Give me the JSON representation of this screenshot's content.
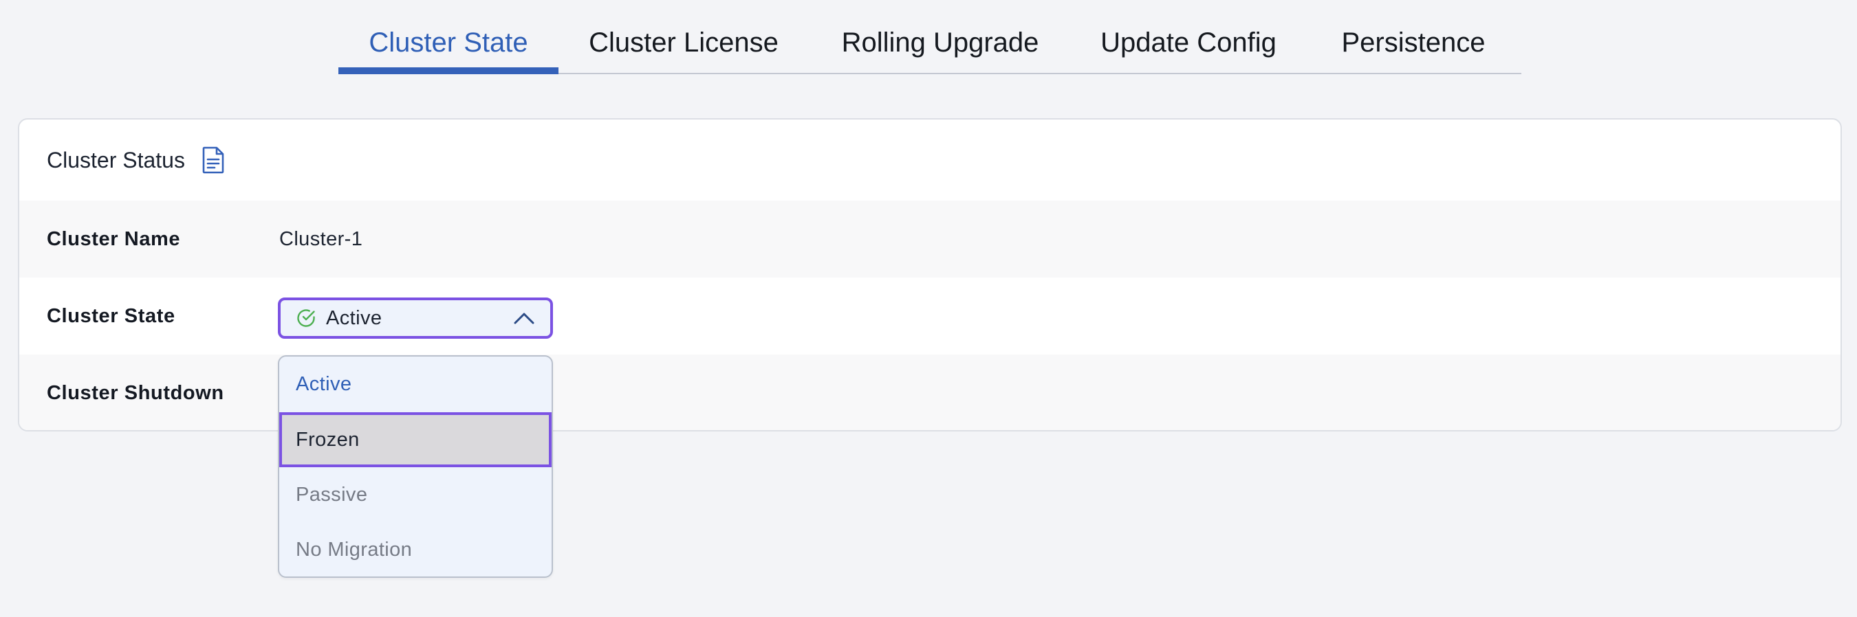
{
  "tabs": [
    {
      "label": "Cluster State",
      "active": true
    },
    {
      "label": "Cluster License",
      "active": false
    },
    {
      "label": "Rolling Upgrade",
      "active": false
    },
    {
      "label": "Update Config",
      "active": false
    },
    {
      "label": "Persistence",
      "active": false
    }
  ],
  "panel": {
    "title": "Cluster Status",
    "title_icon": "document-icon",
    "rows": [
      {
        "label": "Cluster Name",
        "value": "Cluster-1"
      },
      {
        "label": "Cluster State",
        "value": ""
      },
      {
        "label": "Cluster Shutdown",
        "value": ""
      }
    ]
  },
  "cluster_state_select": {
    "value": "Active",
    "status_icon": "check-circle-icon",
    "toggle_icon": "chevron-up-icon",
    "expanded": true,
    "options": [
      {
        "label": "Active",
        "state": "selected"
      },
      {
        "label": "Frozen",
        "state": "highlighted"
      },
      {
        "label": "Passive",
        "state": "normal"
      },
      {
        "label": "No Migration",
        "state": "normal"
      }
    ]
  },
  "colors": {
    "accent": "#3461b9",
    "focus_border": "#7b52e3",
    "success": "#4caf50",
    "page_background": "#f3f4f7"
  }
}
